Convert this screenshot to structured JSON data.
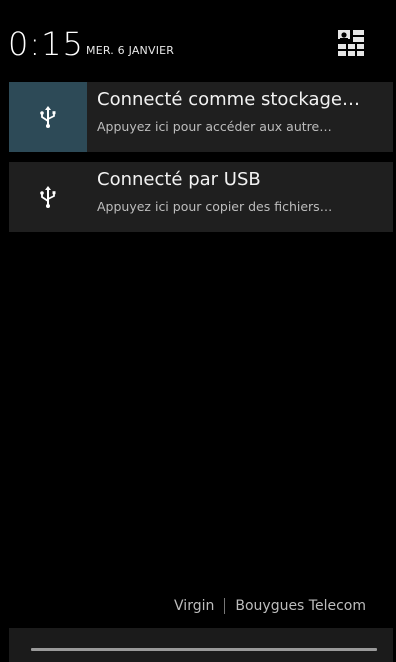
{
  "status": {
    "time": "0:15",
    "date": "MER. 6 JANVIER"
  },
  "notifications": [
    {
      "icon": "usb-icon",
      "title": "Connecté comme stockage…",
      "subtitle": "Appuyez ici pour accéder aux autre…"
    },
    {
      "icon": "usb-icon",
      "title": "Connecté par USB",
      "subtitle": "Appuyez ici pour copier des fichiers…"
    }
  ],
  "carrier": {
    "left": "Virgin",
    "right": "Bouygues Telecom"
  },
  "colors": {
    "background": "#000000",
    "card": "#1f1f1f",
    "highlight": "#2d4a57"
  }
}
